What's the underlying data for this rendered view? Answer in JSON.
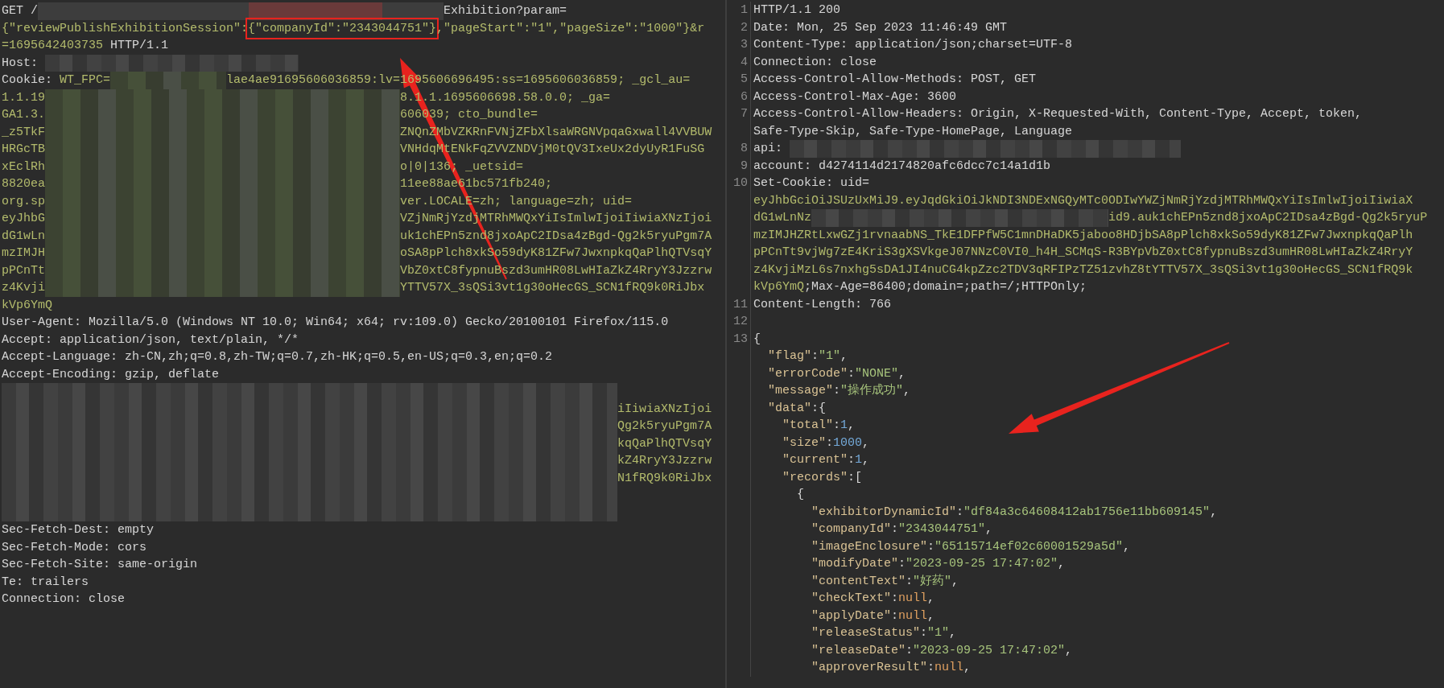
{
  "request": {
    "lines": [
      {
        "parts": [
          {
            "kind": "plain",
            "text": "GET /"
          },
          {
            "kind": "redacted"
          },
          {
            "kind": "plain",
            "text": "Exhibition?param="
          }
        ]
      },
      {
        "parts": [
          {
            "kind": "value",
            "text": "{\"reviewPublishExhibitionSession\":"
          },
          {
            "kind": "value",
            "text": "{\"companyId\":\"2343044751\"}",
            "highlighted": true
          },
          {
            "kind": "value",
            "text": ",\"pageStart\":\"1\",\"pageSize\":\"1000\"}&r"
          }
        ]
      },
      {
        "parts": [
          {
            "kind": "value",
            "text": "=1695642403735"
          },
          {
            "kind": "plain",
            "text": " HTTP/1.1"
          }
        ]
      },
      {
        "parts": [
          {
            "kind": "plain",
            "text": "Host: "
          },
          {
            "kind": "redacted"
          }
        ]
      },
      {
        "parts": [
          {
            "kind": "plain",
            "text": "Cookie: "
          },
          {
            "kind": "value",
            "text": "WT_FPC="
          },
          {
            "kind": "redacted"
          },
          {
            "kind": "value",
            "text": "lae4ae91695606036859:lv=1695606696495:ss=1695606036859; _gcl_au="
          }
        ]
      },
      {
        "parts": [
          {
            "kind": "value",
            "text": "1.1.19"
          },
          {
            "kind": "redacted"
          },
          {
            "kind": "value",
            "text": "8.1.1.1695606698.58.0.0; _ga="
          }
        ]
      },
      {
        "parts": [
          {
            "kind": "value",
            "text": "GA1.3."
          },
          {
            "kind": "redacted"
          },
          {
            "kind": "value",
            "text": "606039; cto_bundle="
          }
        ]
      },
      {
        "parts": [
          {
            "kind": "value",
            "text": "_z5TkF"
          },
          {
            "kind": "redacted"
          },
          {
            "kind": "value",
            "text": "ZNQnZMbVZKRnFVNjZFbXlsaWRGNVpqaGxwall4VVBUW"
          }
        ]
      },
      {
        "parts": [
          {
            "kind": "value",
            "text": "HRGcTB"
          },
          {
            "kind": "redacted"
          },
          {
            "kind": "value",
            "text": "VNHdqMtENkFqZVVZNDVjM0tQV3IxeUx2dyUyR1FuSG"
          }
        ]
      },
      {
        "parts": [
          {
            "kind": "value",
            "text": "xEclRh"
          },
          {
            "kind": "redacted"
          },
          {
            "kind": "value",
            "text": "o|0|136; _uetsid="
          }
        ]
      },
      {
        "parts": [
          {
            "kind": "value",
            "text": "8820ea"
          },
          {
            "kind": "redacted"
          },
          {
            "kind": "value",
            "text": "11ee88ae61bc571fb240;"
          }
        ]
      },
      {
        "parts": [
          {
            "kind": "value",
            "text": "org.sp"
          },
          {
            "kind": "redacted"
          },
          {
            "kind": "value",
            "text": "ver.LOCALE=zh; language=zh; uid="
          }
        ]
      },
      {
        "parts": [
          {
            "kind": "value",
            "text": "eyJhbG"
          },
          {
            "kind": "redacted"
          },
          {
            "kind": "value",
            "text": "VZjNmRjYzdjMTRhMWQxYiIsImlwIjoiIiwiaXNzIjoi"
          }
        ]
      },
      {
        "parts": [
          {
            "kind": "value",
            "text": "dG1wLn"
          },
          {
            "kind": "redacted"
          },
          {
            "kind": "value",
            "text": "uk1chEPn5znd8jxoApC2IDsa4zBgd-Qg2k5ryuPgm7A"
          }
        ]
      },
      {
        "parts": [
          {
            "kind": "value",
            "text": "mzIMJH"
          },
          {
            "kind": "redacted"
          },
          {
            "kind": "value",
            "text": "oSA8pPlch8xkSo59dyK81ZFw7JwxnpkqQaPlhQTVsqY"
          }
        ]
      },
      {
        "parts": [
          {
            "kind": "value",
            "text": "pPCnTt"
          },
          {
            "kind": "redacted"
          },
          {
            "kind": "value",
            "text": "VbZ0xtC8fypnuBszd3umHR08LwHIaZkZ4RryY3Jzzrw"
          }
        ]
      },
      {
        "parts": [
          {
            "kind": "value",
            "text": "z4Kvji"
          },
          {
            "kind": "redacted"
          },
          {
            "kind": "value",
            "text": "YTTV57X_3sQSi3vt1g30oHecGS_SCN1fRQ9k0RiJbx"
          }
        ]
      },
      {
        "parts": [
          {
            "kind": "value",
            "text": "kVp6YmQ"
          }
        ]
      },
      {
        "parts": [
          {
            "kind": "plain",
            "text": "User-Agent: Mozilla/5.0 (Windows NT 10.0; Win64; x64; rv:109.0) Gecko/20100101 Firefox/115.0"
          }
        ]
      },
      {
        "parts": [
          {
            "kind": "plain",
            "text": "Accept: application/json, text/plain, */*"
          }
        ]
      },
      {
        "parts": [
          {
            "kind": "plain",
            "text": "Accept-Language: zh-CN,zh;q=0.8,zh-TW;q=0.7,zh-HK;q=0.5,en-US;q=0.3,en;q=0.2"
          }
        ]
      },
      {
        "parts": [
          {
            "kind": "plain",
            "text": "Accept-Encoding: gzip, deflate"
          }
        ]
      },
      {
        "parts": [
          {
            "kind": "redacted"
          }
        ]
      },
      {
        "parts": [
          {
            "kind": "redacted"
          },
          {
            "kind": "value",
            "text": "iIiwiaXNzIjoi"
          }
        ]
      },
      {
        "parts": [
          {
            "kind": "redacted"
          },
          {
            "kind": "value",
            "text": "Qg2k5ryuPgm7A"
          }
        ]
      },
      {
        "parts": [
          {
            "kind": "redacted"
          },
          {
            "kind": "value",
            "text": "kqQaPlhQTVsqY"
          }
        ]
      },
      {
        "parts": [
          {
            "kind": "redacted"
          },
          {
            "kind": "value",
            "text": "kZ4RryY3Jzzrw"
          }
        ]
      },
      {
        "parts": [
          {
            "kind": "redacted"
          },
          {
            "kind": "value",
            "text": "N1fRQ9k0RiJbx"
          }
        ]
      },
      {
        "parts": [
          {
            "kind": "redacted"
          }
        ]
      },
      {
        "parts": [
          {
            "kind": "redacted"
          }
        ]
      },
      {
        "parts": [
          {
            "kind": "plain",
            "text": "Sec-Fetch-Dest: empty"
          }
        ]
      },
      {
        "parts": [
          {
            "kind": "plain",
            "text": "Sec-Fetch-Mode: cors"
          }
        ]
      },
      {
        "parts": [
          {
            "kind": "plain",
            "text": "Sec-Fetch-Site: same-origin"
          }
        ]
      },
      {
        "parts": [
          {
            "kind": "plain",
            "text": "Te: trailers"
          }
        ]
      },
      {
        "parts": [
          {
            "kind": "plain",
            "text": "Connection: close"
          }
        ]
      }
    ]
  },
  "response": {
    "rows": [
      {
        "number": "1",
        "parts": [
          {
            "kind": "plain",
            "text": "HTTP/1.1 200"
          }
        ]
      },
      {
        "number": "2",
        "parts": [
          {
            "kind": "plain",
            "text": "Date: Mon, 25 Sep 2023 11:46:49 GMT"
          }
        ]
      },
      {
        "number": "3",
        "parts": [
          {
            "kind": "plain",
            "text": "Content-Type: application/json;charset=UTF-8"
          }
        ]
      },
      {
        "number": "4",
        "parts": [
          {
            "kind": "plain",
            "text": "Connection: close"
          }
        ]
      },
      {
        "number": "5",
        "parts": [
          {
            "kind": "plain",
            "text": "Access-Control-Allow-Methods: POST, GET"
          }
        ]
      },
      {
        "number": "6",
        "parts": [
          {
            "kind": "plain",
            "text": "Access-Control-Max-Age: 3600"
          }
        ]
      },
      {
        "number": "7",
        "parts": [
          {
            "kind": "plain",
            "text": "Access-Control-Allow-Headers: Origin, X-Requested-With, Content-Type, Accept, token,"
          }
        ]
      },
      {
        "parts": [
          {
            "kind": "plain",
            "text": "Safe-Type-Skip, Safe-Type-HomePage, Language"
          }
        ]
      },
      {
        "number": "8",
        "parts": [
          {
            "kind": "plain",
            "text": "api: "
          },
          {
            "kind": "redacted"
          }
        ]
      },
      {
        "number": "9",
        "parts": [
          {
            "kind": "plain",
            "text": "account: d4274114d2174820afc6dcc7c14a1d1b"
          }
        ]
      },
      {
        "number": "10",
        "parts": [
          {
            "kind": "plain",
            "text": "Set-Cookie: uid="
          }
        ]
      },
      {
        "parts": [
          {
            "kind": "value",
            "text": "eyJhbGciOiJSUzUxMiJ9.eyJqdGkiOiJkNDI3NDExNGQyMTc0ODIwYWZjNmRjYzdjMTRhMWQxYiIsImlwIjoiIiwiaX"
          }
        ]
      },
      {
        "parts": [
          {
            "kind": "value",
            "text": "dG1wLnNz"
          },
          {
            "kind": "redacted"
          },
          {
            "kind": "value",
            "text": "id9.auk1chEPn5znd8jxoApC2IDsa4zBgd-Qg2k5ryuP"
          }
        ]
      },
      {
        "parts": [
          {
            "kind": "value",
            "text": "mzIMJHZRtLxwGZj1rvnaabNS_TkE1DFPfW5C1mnDHaDK5jaboo8HDjbSA8pPlch8xkSo59dyK81ZFw7JwxnpkqQaPlh"
          }
        ]
      },
      {
        "parts": [
          {
            "kind": "value",
            "text": "pPCnTt9vjWg7zE4KriS3gXSVkgeJ07NNzC0VI0_h4H_SCMqS-R3BYpVbZ0xtC8fypnuBszd3umHR08LwHIaZkZ4RryY"
          }
        ]
      },
      {
        "parts": [
          {
            "kind": "value",
            "text": "z4KvjiMzL6s7nxhg5sDA1JI4nuCG4kpZzc2TDV3qRFIPzTZ51zvhZ8tYTTV57X_3sQSi3vt1g30oHecGS_SCN1fRQ9k"
          }
        ]
      },
      {
        "parts": [
          {
            "kind": "value",
            "text": "kVp6YmQ"
          },
          {
            "kind": "plain",
            "text": ";Max-Age=86400;domain=;path=/;HTTPOnly;"
          }
        ]
      },
      {
        "number": "11",
        "parts": [
          {
            "kind": "plain",
            "text": "Content-Length: 766"
          }
        ]
      },
      {
        "number": "12",
        "parts": []
      },
      {
        "number": "13",
        "parts": [
          {
            "kind": "plain",
            "text": "{"
          }
        ]
      },
      {
        "parts": [
          {
            "kind": "key",
            "text": "  \"flag\""
          },
          {
            "kind": "plain",
            "text": ":"
          },
          {
            "kind": "string",
            "text": "\"1\""
          },
          {
            "kind": "plain",
            "text": ","
          }
        ]
      },
      {
        "parts": [
          {
            "kind": "key",
            "text": "  \"errorCode\""
          },
          {
            "kind": "plain",
            "text": ":"
          },
          {
            "kind": "string",
            "text": "\"NONE\""
          },
          {
            "kind": "plain",
            "text": ","
          }
        ]
      },
      {
        "parts": [
          {
            "kind": "key",
            "text": "  \"message\""
          },
          {
            "kind": "plain",
            "text": ":"
          },
          {
            "kind": "string",
            "text": "\"操作成功\""
          },
          {
            "kind": "plain",
            "text": ","
          }
        ]
      },
      {
        "parts": [
          {
            "kind": "key",
            "text": "  \"data\""
          },
          {
            "kind": "plain",
            "text": ":{"
          }
        ]
      },
      {
        "parts": [
          {
            "kind": "key",
            "text": "    \"total\""
          },
          {
            "kind": "plain",
            "text": ":"
          },
          {
            "kind": "number",
            "text": "1"
          },
          {
            "kind": "plain",
            "text": ","
          }
        ]
      },
      {
        "parts": [
          {
            "kind": "key",
            "text": "    \"size\""
          },
          {
            "kind": "plain",
            "text": ":"
          },
          {
            "kind": "number",
            "text": "1000"
          },
          {
            "kind": "plain",
            "text": ","
          }
        ]
      },
      {
        "parts": [
          {
            "kind": "key",
            "text": "    \"current\""
          },
          {
            "kind": "plain",
            "text": ":"
          },
          {
            "kind": "number",
            "text": "1"
          },
          {
            "kind": "plain",
            "text": ","
          }
        ]
      },
      {
        "parts": [
          {
            "kind": "key",
            "text": "    \"records\""
          },
          {
            "kind": "plain",
            "text": ":["
          }
        ]
      },
      {
        "parts": [
          {
            "kind": "plain",
            "text": "      {"
          }
        ]
      },
      {
        "parts": [
          {
            "kind": "key",
            "text": "        \"exhibitorDynamicId\""
          },
          {
            "kind": "plain",
            "text": ":"
          },
          {
            "kind": "string",
            "text": "\"df84a3c64608412ab1756e11bb609145\""
          },
          {
            "kind": "plain",
            "text": ","
          }
        ]
      },
      {
        "parts": [
          {
            "kind": "key",
            "text": "        \"companyId\""
          },
          {
            "kind": "plain",
            "text": ":"
          },
          {
            "kind": "string",
            "text": "\"2343044751\""
          },
          {
            "kind": "plain",
            "text": ","
          }
        ]
      },
      {
        "parts": [
          {
            "kind": "key",
            "text": "        \"imageEnclosure\""
          },
          {
            "kind": "plain",
            "text": ":"
          },
          {
            "kind": "string",
            "text": "\"65115714ef02c60001529a5d\""
          },
          {
            "kind": "plain",
            "text": ","
          }
        ]
      },
      {
        "parts": [
          {
            "kind": "key",
            "text": "        \"modifyDate\""
          },
          {
            "kind": "plain",
            "text": ":"
          },
          {
            "kind": "string",
            "text": "\"2023-09-25 17:47:02\""
          },
          {
            "kind": "plain",
            "text": ","
          }
        ]
      },
      {
        "parts": [
          {
            "kind": "key",
            "text": "        \"contentText\""
          },
          {
            "kind": "plain",
            "text": ":"
          },
          {
            "kind": "string",
            "text": "\"好药\""
          },
          {
            "kind": "plain",
            "text": ","
          }
        ]
      },
      {
        "parts": [
          {
            "kind": "key",
            "text": "        \"checkText\""
          },
          {
            "kind": "plain",
            "text": ":"
          },
          {
            "kind": "null",
            "text": "null"
          },
          {
            "kind": "plain",
            "text": ","
          }
        ]
      },
      {
        "parts": [
          {
            "kind": "key",
            "text": "        \"applyDate\""
          },
          {
            "kind": "plain",
            "text": ":"
          },
          {
            "kind": "null",
            "text": "null"
          },
          {
            "kind": "plain",
            "text": ","
          }
        ]
      },
      {
        "parts": [
          {
            "kind": "key",
            "text": "        \"releaseStatus\""
          },
          {
            "kind": "plain",
            "text": ":"
          },
          {
            "kind": "string",
            "text": "\"1\""
          },
          {
            "kind": "plain",
            "text": ","
          }
        ]
      },
      {
        "parts": [
          {
            "kind": "key",
            "text": "        \"releaseDate\""
          },
          {
            "kind": "plain",
            "text": ":"
          },
          {
            "kind": "string",
            "text": "\"2023-09-25 17:47:02\""
          },
          {
            "kind": "plain",
            "text": ","
          }
        ]
      },
      {
        "parts": [
          {
            "kind": "key",
            "text": "        \"approverResult\""
          },
          {
            "kind": "plain",
            "text": ":"
          },
          {
            "kind": "null",
            "text": "null"
          },
          {
            "kind": "plain",
            "text": ","
          }
        ]
      }
    ]
  }
}
